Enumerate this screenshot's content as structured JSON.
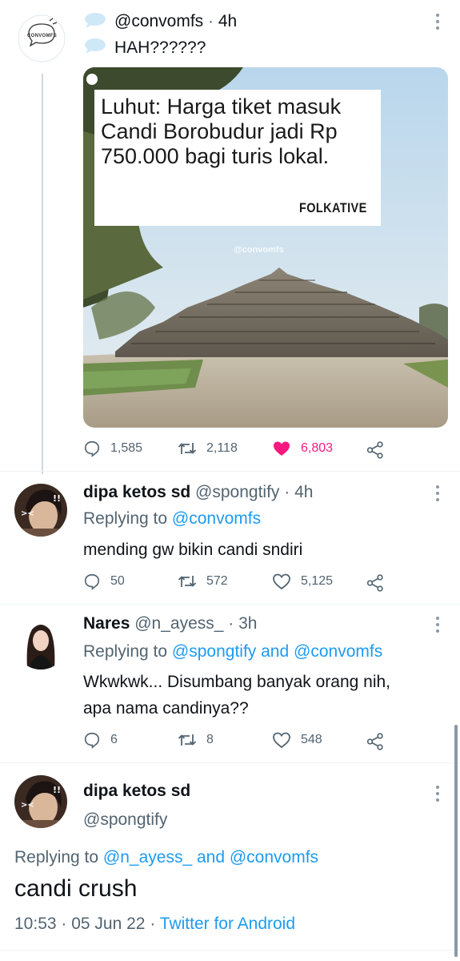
{
  "tweet1": {
    "handle": "@convomfs",
    "time": "4h",
    "text": "HAH??????",
    "avatar_label": "CONVOMFS",
    "image": {
      "headline": "Luhut: Harga tiket masuk Candi Borobudur jadi Rp 750.000 bagi turis lokal.",
      "brand": "FOLKATIVE",
      "watermark": "@convomfs"
    },
    "replies": "1,585",
    "retweets": "2,118",
    "likes": "6,803",
    "liked": true
  },
  "tweet2": {
    "name": "dipa ketos sd",
    "handle": "@spongtify",
    "time": "4h",
    "replying_prefix": "Replying to",
    "replying_to": "@convomfs",
    "text": "mending gw bikin candi sndiri",
    "replies": "50",
    "retweets": "572",
    "likes": "5,125"
  },
  "tweet3": {
    "name": "Nares",
    "handle": "@n_ayess_",
    "time": "3h",
    "replying_prefix": "Replying to",
    "replying_to_1": "@spongtify",
    "replying_and": "and",
    "replying_to_2": "@convomfs",
    "text_line1": "Wkwkwk... Disumbang banyak orang nih,",
    "text_line2": "apa nama candinya??",
    "replies": "6",
    "retweets": "8",
    "likes": "548"
  },
  "tweet4": {
    "name": "dipa ketos sd",
    "handle": "@spongtify",
    "replying_prefix": "Replying to",
    "replying_to_1": "@n_ayess_",
    "replying_and": "and",
    "replying_to_2": "@convomfs",
    "text": "candi crush",
    "time": "10:53",
    "date": "05 Jun 22",
    "source": "Twitter for Android"
  },
  "colors": {
    "link": "#1d9bf0",
    "like": "#f91880",
    "muted": "#536471"
  }
}
